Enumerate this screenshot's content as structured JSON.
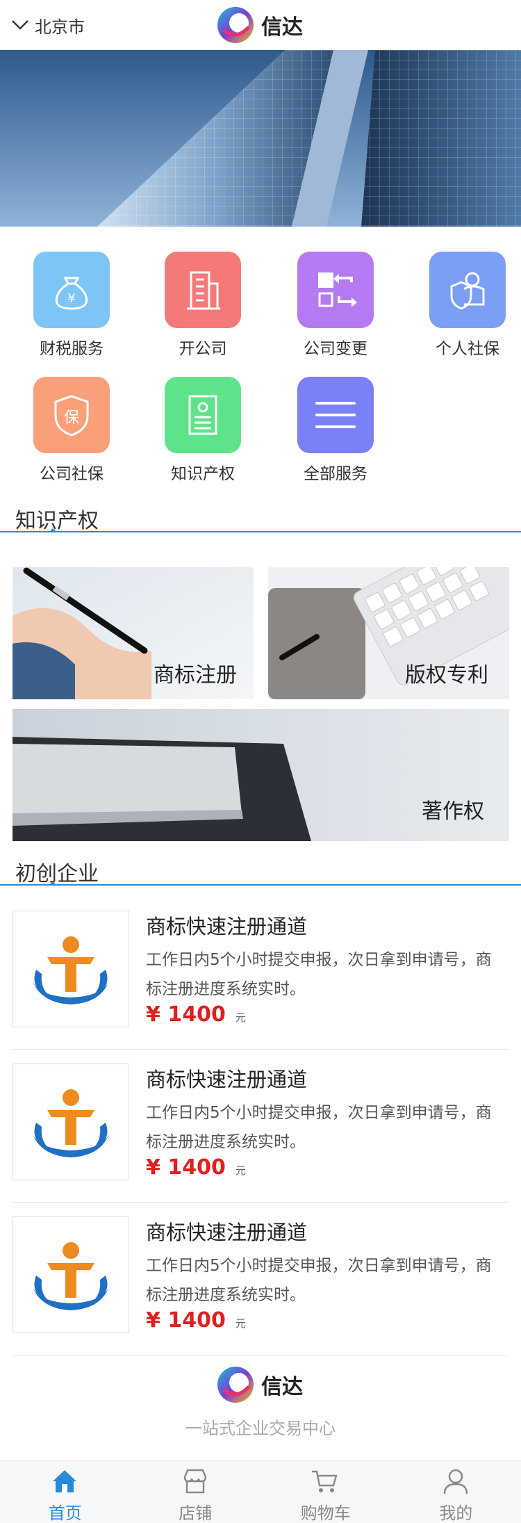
{
  "header": {
    "city": "北京市",
    "brand_name": "信达"
  },
  "services": [
    {
      "label": "财税服务",
      "color": "#7ec5f7",
      "icon": "money-bag-icon"
    },
    {
      "label": "开公司",
      "color": "#f47a7a",
      "icon": "building-icon"
    },
    {
      "label": "公司变更",
      "color": "#b57af2",
      "icon": "swap-icon"
    },
    {
      "label": "个人社保",
      "color": "#7a9ff5",
      "icon": "person-shield-icon"
    },
    {
      "label": "公司社保",
      "color": "#f9a07a",
      "icon": "shield-bao-icon"
    },
    {
      "label": "知识产权",
      "color": "#5fe38a",
      "icon": "certificate-icon"
    },
    {
      "label": "全部服务",
      "color": "#7a80f5",
      "icon": "menu-icon"
    }
  ],
  "sections": {
    "ip_title": "知识产权",
    "startup_title": "初创企业"
  },
  "ip_cards": [
    {
      "label": "商标注册"
    },
    {
      "label": "版权专利"
    },
    {
      "label": "著作权"
    }
  ],
  "products": [
    {
      "title": "商标快速注册通道",
      "desc": "工作日内5个小时提交申报，次日拿到申请号，商标注册进度系统实时。",
      "price": "¥ 1400",
      "unit": "元"
    },
    {
      "title": "商标快速注册通道",
      "desc": "工作日内5个小时提交申报，次日拿到申请号，商标注册进度系统实时。",
      "price": "¥ 1400",
      "unit": "元"
    },
    {
      "title": "商标快速注册通道",
      "desc": "工作日内5个小时提交申报，次日拿到申请号，商标注册进度系统实时。",
      "price": "¥ 1400",
      "unit": "元"
    }
  ],
  "footer": {
    "brand_name": "信达",
    "slogan": "一站式企业交易中心"
  },
  "bottom_nav": [
    {
      "label": "首页",
      "icon": "home-icon",
      "active": true
    },
    {
      "label": "店铺",
      "icon": "store-icon",
      "active": false
    },
    {
      "label": "购物车",
      "icon": "cart-icon",
      "active": false
    },
    {
      "label": "我的",
      "icon": "user-icon",
      "active": false
    }
  ],
  "colors": {
    "accent": "#2a8ad8",
    "price": "#e02020"
  }
}
